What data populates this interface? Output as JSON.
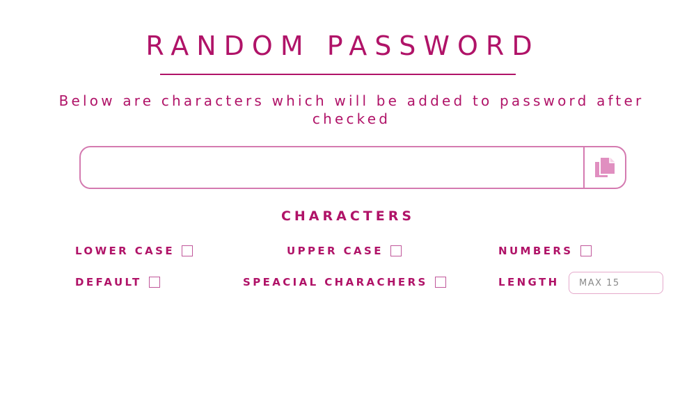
{
  "header": {
    "title": "RANDOM PASSWORD",
    "subtitle": "Below are characters which will be added to password after checked"
  },
  "output": {
    "password_value": "",
    "copy_icon": "copy-icon"
  },
  "characters": {
    "heading": "CHARACTERS",
    "options": {
      "lower_case": {
        "label": "LOWER CASE",
        "checked": false
      },
      "upper_case": {
        "label": "UPPER CASE",
        "checked": false
      },
      "numbers": {
        "label": "NUMBERS",
        "checked": false
      },
      "default": {
        "label": "DEFAULT",
        "checked": false
      },
      "special": {
        "label": "SPEACIAL CHARACHERS",
        "checked": false
      }
    },
    "length": {
      "label": "LENGTH",
      "placeholder": "MAX 15",
      "value": ""
    }
  },
  "colors": {
    "accent": "#b01368",
    "border": "#d47ab0",
    "icon": "#e08fc0"
  }
}
